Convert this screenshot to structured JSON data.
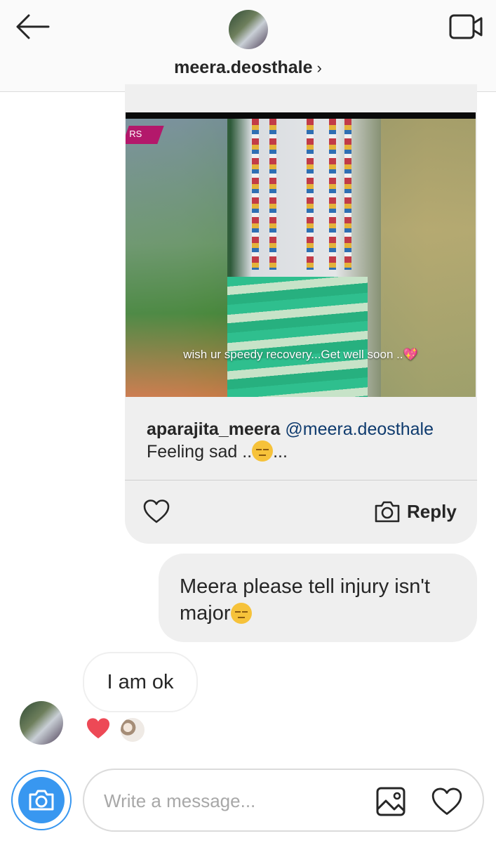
{
  "header": {
    "username": "meera.deosthale",
    "chevron": "›",
    "back_icon": "arrow-left-icon",
    "video_icon": "video-call-icon"
  },
  "shared_post": {
    "tag": "RS",
    "caption": "wish ur speedy recovery...Get well soon ..💖",
    "author": "aparajita_meera",
    "mention": "@meera.deosthale",
    "text_before": "Feeling sad ..",
    "text_after": "...",
    "reply_label": "Reply"
  },
  "messages": {
    "sent_line1": "Meera please tell injury isn't",
    "sent_line2": "major",
    "received": "I am ok"
  },
  "composer": {
    "placeholder": "Write a message..."
  },
  "colors": {
    "accent": "#3897f0",
    "heart": "#ed4956",
    "bubble": "#efefef",
    "mention": "#0f3b6e"
  }
}
